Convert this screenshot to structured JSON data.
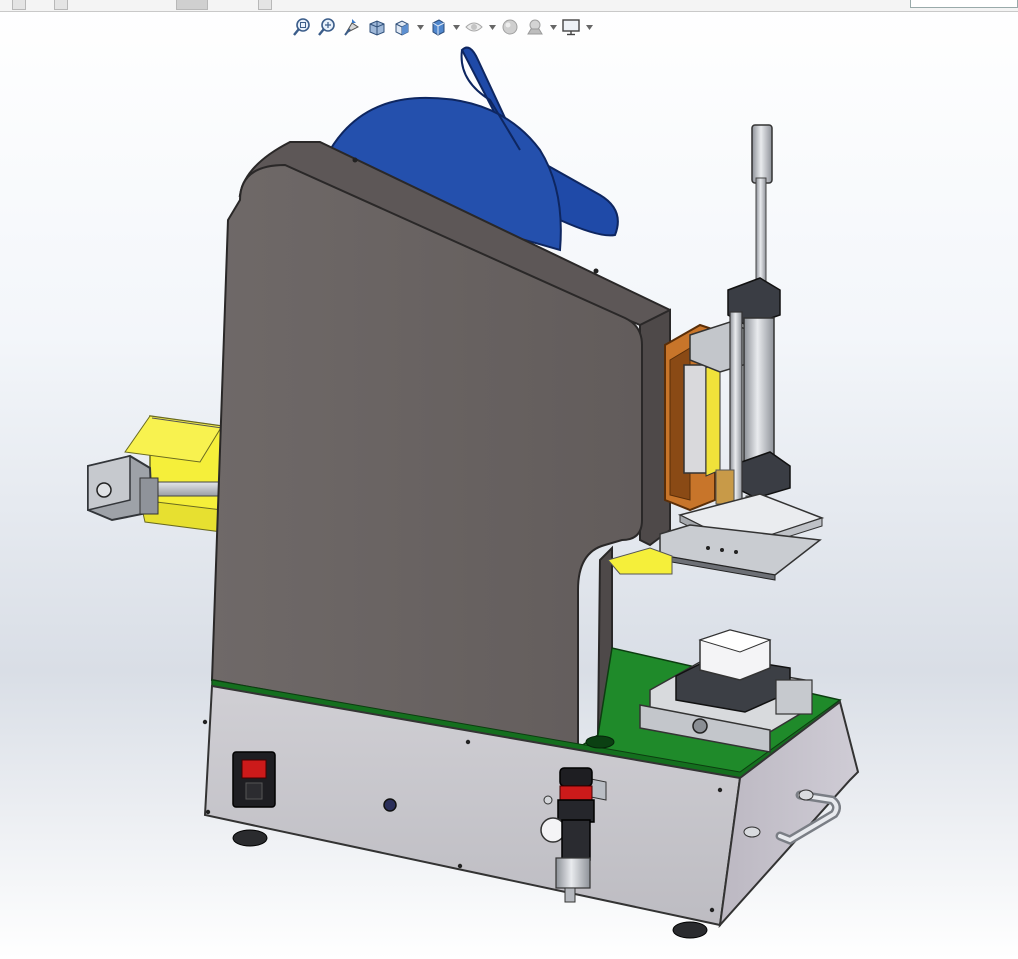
{
  "view_toolbar": {
    "buttons": [
      {
        "name": "zoom-to-fit-icon",
        "has_menu": false
      },
      {
        "name": "zoom-to-area-icon",
        "has_menu": false
      },
      {
        "name": "previous-view-icon",
        "has_menu": false
      },
      {
        "name": "section-view-icon",
        "has_menu": false
      },
      {
        "name": "view-orientation-icon",
        "has_menu": true
      },
      {
        "name": "display-style-icon",
        "has_menu": true
      },
      {
        "name": "hide-show-items-icon",
        "has_menu": true
      },
      {
        "name": "edit-appearance-icon",
        "has_menu": false
      },
      {
        "name": "apply-scene-icon",
        "has_menu": true
      },
      {
        "name": "view-settings-icon",
        "has_menu": true
      }
    ]
  },
  "colors": {
    "housing_gray": "#6b6463",
    "housing_edge": "#4a4545",
    "base_panel": "#c7c6cc",
    "base_plate_green": "#1f8a2a",
    "fan_blue": "#1f4aa8",
    "conveyor_yellow": "#f5ef3a",
    "mount_orange": "#c8752a",
    "steel": "#b9bdc4",
    "accent_red": "#cc1a1a"
  }
}
